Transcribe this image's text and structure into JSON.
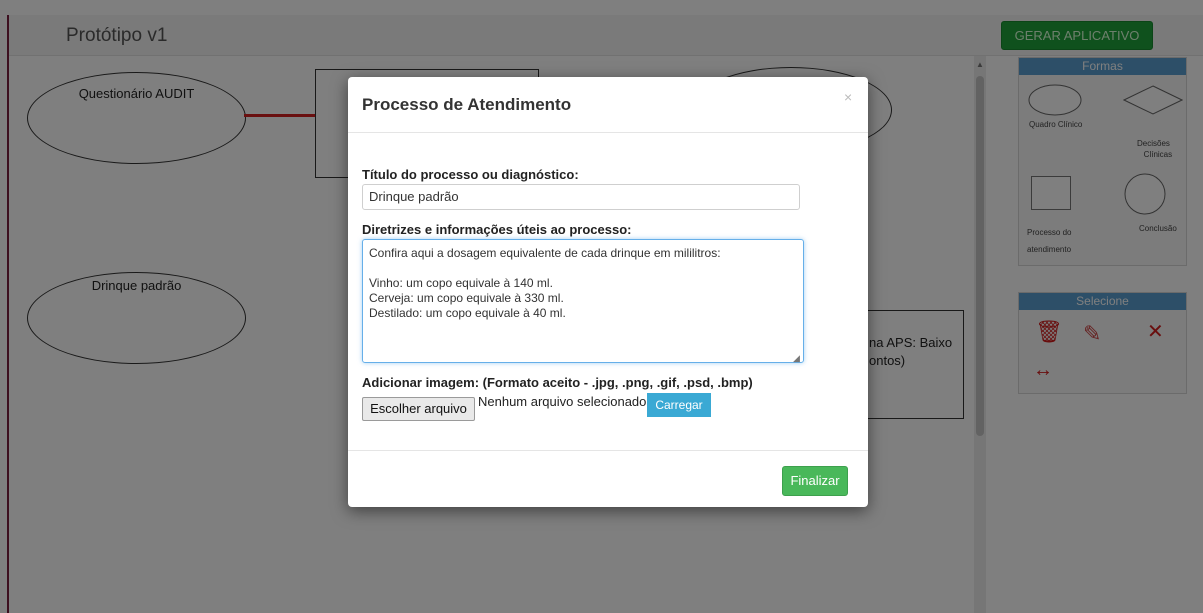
{
  "app": {
    "title": "Protótipo v1",
    "generate_button": "GERAR APLICATIVO"
  },
  "canvas": {
    "nodes": [
      {
        "label": "Questionário AUDIT"
      },
      {
        "label": "Drinque padrão"
      },
      {
        "label": "na APS: Baixo"
      },
      {
        "label": "ontos)"
      }
    ]
  },
  "shapes_panel": {
    "header": "Formas",
    "items": [
      {
        "label": "Quadro Clínico",
        "icon": "ellipse-shape-icon"
      },
      {
        "label": "Decisões Clínicas",
        "icon": "diamond-shape-icon"
      },
      {
        "label": "Processo do atendimento",
        "icon": "rectangle-shape-icon"
      },
      {
        "label": "Conclusão",
        "icon": "circle-shape-icon"
      }
    ]
  },
  "select_panel": {
    "header": "Selecione",
    "tools": [
      "trash-icon",
      "edit-icon",
      "expand-icon",
      "connect-arrows-icon"
    ]
  },
  "modal": {
    "title": "Processo de Atendimento",
    "close": "×",
    "title_label": "Título do processo ou diagnóstico:",
    "title_value": "Drinque padrão",
    "guidelines_label": "Diretrizes e informações úteis ao processo:",
    "guidelines_value": "Confira aqui a dosagem equivalente de cada drinque em mililitros:\n\nVinho: um copo equivale à 140 ml.\nCerveja: um copo equivale à 330 ml.\nDestilado: um copo equivale à 40 ml.",
    "image_label": "Adicionar imagem: (Formato aceito - .jpg, .png, .gif, .psd, .bmp)",
    "file_button": "Escolher arquivo",
    "file_status": "Nenhum arquivo selecionado",
    "upload_button": "Carregar",
    "finish_button": "Finalizar"
  },
  "colors": {
    "primary_green": "#49b85a",
    "header_blue": "#5a9fd0",
    "danger_red": "#d21c1c",
    "upload_blue": "#3aa9d4"
  }
}
